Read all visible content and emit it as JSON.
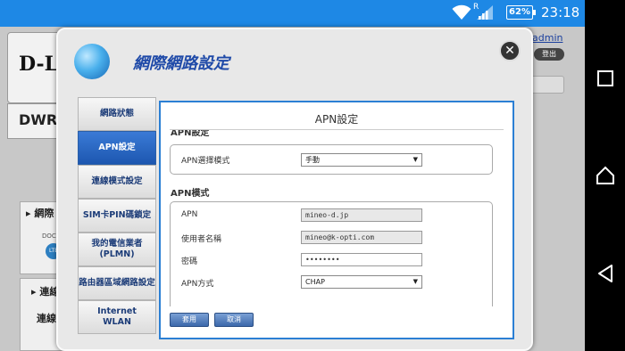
{
  "status_bar": {
    "roaming": "R",
    "battery": "62%",
    "time": "23:18"
  },
  "background": {
    "logo": "D-L",
    "model": "DWR",
    "user": "admin",
    "logout": "登出",
    "panel1_title": "▸ 網際",
    "panel1_text": "DOC",
    "panel1_badge": "LTE",
    "panel2_title": "▸ 連線",
    "panel2_text": "連線"
  },
  "modal": {
    "title": "網際網路設定",
    "close": "✕"
  },
  "menu": {
    "items": [
      {
        "label": "網路狀態"
      },
      {
        "label": "APN設定"
      },
      {
        "label": "連線模式設定"
      },
      {
        "label": "SIM卡PIN碼鎖定"
      },
      {
        "label": "我的電信業者\n(PLMN)"
      },
      {
        "label": "路由器區域網路設定"
      },
      {
        "label": "Internet\nWLAN"
      }
    ]
  },
  "content": {
    "title": "APN設定",
    "clipped_heading": "APN設定",
    "apn_select_mode": {
      "label": "APN選擇模式",
      "value": "手動"
    },
    "apn_mode_heading": "APN模式",
    "fields": {
      "apn": {
        "label": "APN",
        "value": "mineo-d.jp"
      },
      "username": {
        "label": "使用者名稱",
        "value": "mineo@k-opti.com"
      },
      "password": {
        "label": "密碼",
        "value": "••••••••"
      },
      "auth": {
        "label": "APN方式",
        "value": "CHAP"
      }
    },
    "apply_button": "套用",
    "cancel_button": "取消"
  }
}
